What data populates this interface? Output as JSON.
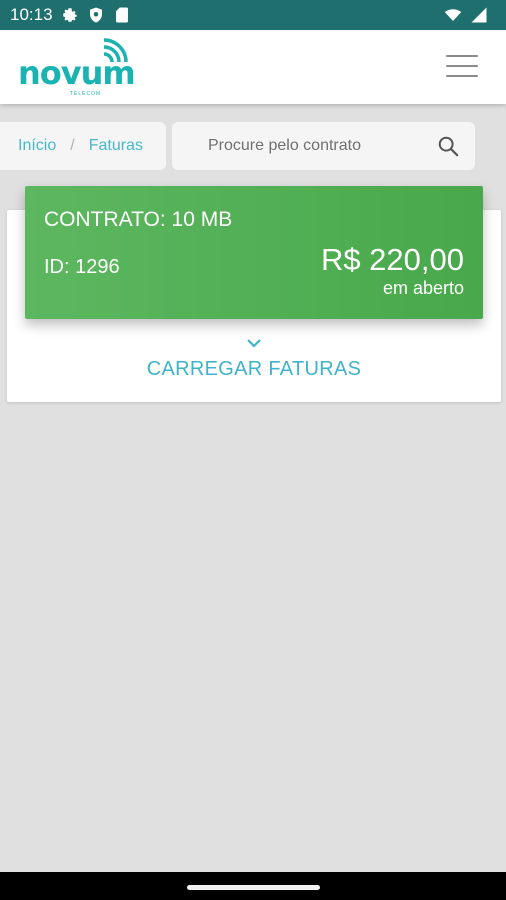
{
  "status_bar": {
    "time": "10:13"
  },
  "app": {
    "logo_text": "novum",
    "logo_sub": "TELECOM",
    "brand_color": "#1ab3b1",
    "menu_icon": "hamburger-menu-icon"
  },
  "breadcrumb": {
    "home": "Início",
    "separator": "/",
    "current": "Faturas"
  },
  "search": {
    "placeholder": "Procure pelo contrato",
    "value": "",
    "icon": "search-icon"
  },
  "contract": {
    "title": "CONTRATO: 10 MB",
    "id": "ID: 1296",
    "amount": "R$ 220,00",
    "status": "em aberto",
    "color": "#4caf50"
  },
  "actions": {
    "load_invoices": "CARREGAR FATURAS"
  },
  "colors": {
    "status_bar": "#1f6f6e",
    "accent": "#3fb3cc",
    "background": "#e0e0e0"
  }
}
